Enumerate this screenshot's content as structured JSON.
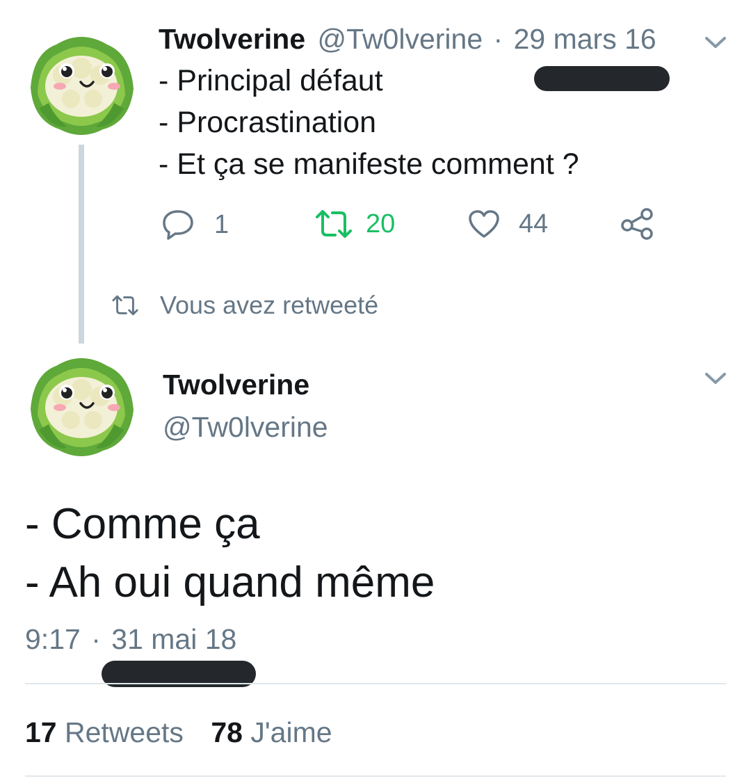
{
  "first_tweet": {
    "name": "Twolverine",
    "handle": "@Tw0lverine",
    "separator": "·",
    "date": "29 mars 16",
    "lines": [
      "- Principal défaut",
      "- Procrastination",
      "- Et ça se manifeste comment ?"
    ],
    "actions": {
      "reply_count": "1",
      "retweet_count": "20",
      "like_count": "44"
    },
    "icons": [
      "reply-icon",
      "retweet-icon",
      "like-icon",
      "share-icon",
      "chevron-down-icon"
    ],
    "retweet_color": "#17bf63"
  },
  "retweet_notice": {
    "label": "Vous avez retweeté"
  },
  "main_tweet": {
    "name": "Twolverine",
    "handle": "@Tw0lverine",
    "lines": [
      "- Comme ça",
      "- Ah oui quand même"
    ],
    "time": "9:17",
    "separator": "·",
    "date": "31 mai 18",
    "stats": {
      "retweets_count": "17",
      "retweets_label": "Retweets",
      "likes_count": "78",
      "likes_label": "J'aime"
    }
  },
  "colors": {
    "text": "#14171a",
    "muted": "#657786",
    "divider": "#e1e8ed",
    "thread_line": "#ccd6dd",
    "redaction": "#24282c"
  }
}
